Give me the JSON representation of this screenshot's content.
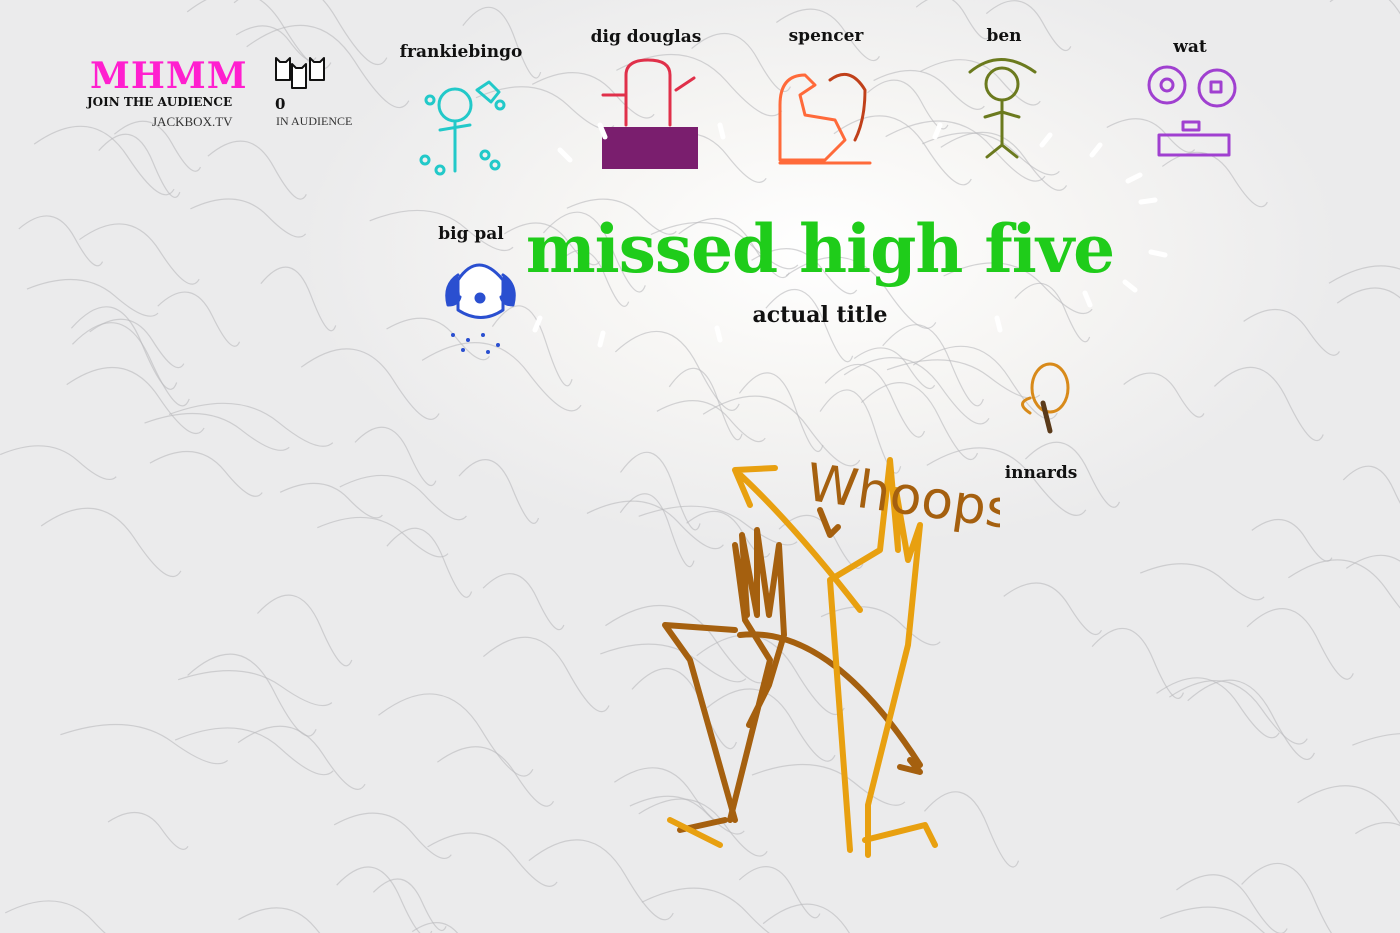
{
  "header": {
    "room_code": "MHMM",
    "join_label": "JOIN THE AUDIENCE",
    "site": "JACKBOX.TV",
    "audience_count": "0",
    "audience_label": "IN AUDIENCE"
  },
  "players": [
    {
      "name": "frankiebingo",
      "color": "#22c9c9"
    },
    {
      "name": "dig douglas",
      "color": "#7a1e6e"
    },
    {
      "name": "spencer",
      "color": "#ff6a3a"
    },
    {
      "name": "ben",
      "color": "#6b7a1e"
    },
    {
      "name": "wat",
      "color": "#a040d0"
    },
    {
      "name": "big pal",
      "color": "#2a4fd0"
    },
    {
      "name": "innards",
      "color": "#d88a1a"
    }
  ],
  "title": "missed high five",
  "subtitle": "actual title",
  "drawing": {
    "caption_text": "Whoops",
    "colors": {
      "hand_left": "#a5600f",
      "hand_right": "#e8a010"
    }
  },
  "colors": {
    "room_code": "#ff1fcf",
    "title": "#1fcc1a"
  }
}
